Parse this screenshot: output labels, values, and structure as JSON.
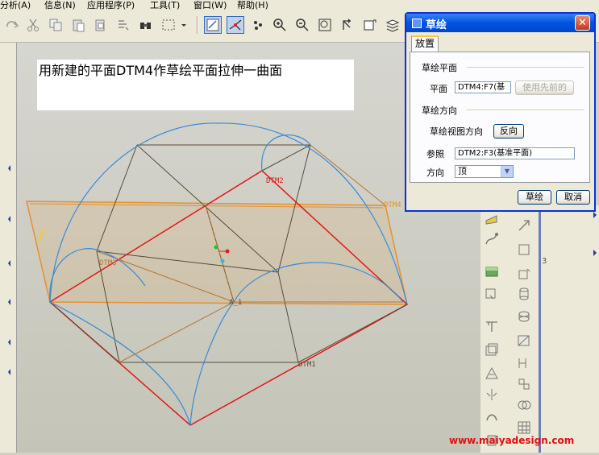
{
  "menu": {
    "items": [
      {
        "label": "分析(A)"
      },
      {
        "label": "信息(N)"
      },
      {
        "label": "应用程序(P)"
      },
      {
        "label": "工具(T)"
      },
      {
        "label": "窗口(W)"
      },
      {
        "label": "帮助(H)"
      }
    ]
  },
  "caption": "用新建的平面DTM4作草绘平面拉伸一曲面",
  "model_labels": {
    "dtm1": "DTM1",
    "dtm2": "DTM2",
    "dtm3": "DTM3",
    "dtm4": "DTM4",
    "axis": "A_1"
  },
  "dialog": {
    "title": "草绘",
    "close": "✕",
    "tab": "放置",
    "sketch_plane_group": "草绘平面",
    "plane_label": "平面",
    "plane_value": "DTM4:F7(基",
    "use_previous": "使用先前的",
    "sketch_dir_group": "草绘方向",
    "view_dir_label": "草绘视图方向",
    "flip": "反向",
    "ref_label": "参照",
    "ref_value": "DTM2:F3(基准平面)",
    "orient_label": "方向",
    "orient_value": "顶",
    "sketch_btn": "草绘",
    "cancel_btn": "取消"
  },
  "side_number": "3",
  "watermark": "www.maiyadesign.com",
  "colors": {
    "titlebar": "#0054e3",
    "dtm4_edge": "#e8902c",
    "dtm_red": "#e01818",
    "curve_blue": "#3a8ad8",
    "watermark": "#e01010"
  }
}
